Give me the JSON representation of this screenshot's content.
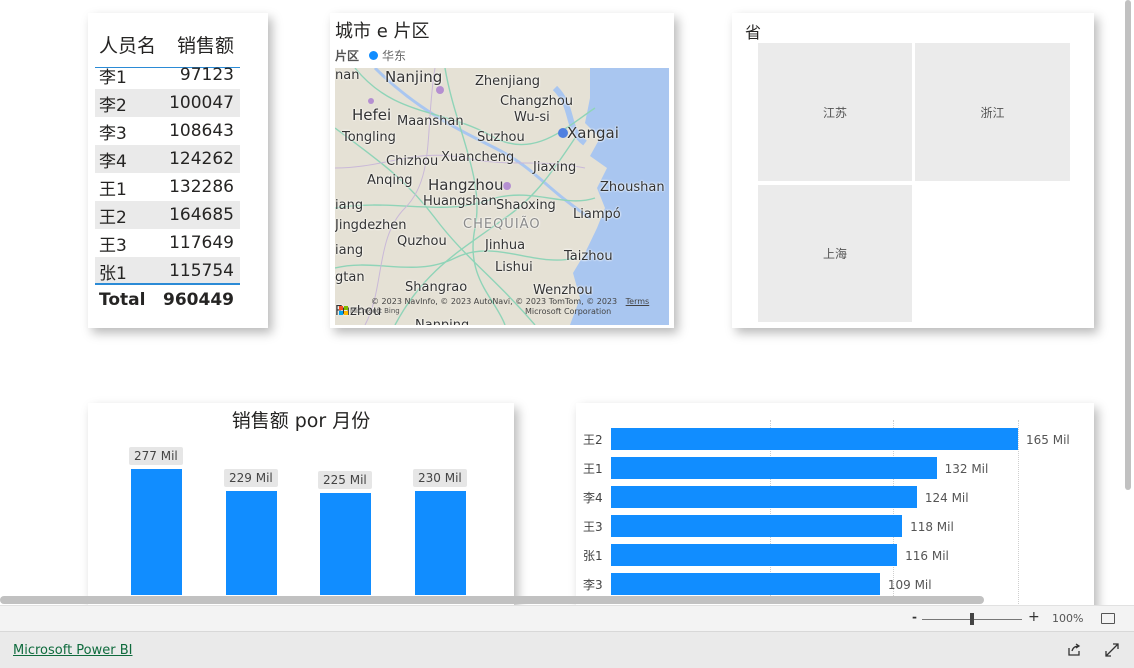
{
  "table": {
    "headers": [
      "人员名",
      "销售额"
    ],
    "rows": [
      {
        "name": "李1",
        "value": "97123"
      },
      {
        "name": "李2",
        "value": "100047"
      },
      {
        "name": "李3",
        "value": "108643"
      },
      {
        "name": "李4",
        "value": "124262"
      },
      {
        "name": "王1",
        "value": "132286"
      },
      {
        "name": "王2",
        "value": "164685"
      },
      {
        "name": "王3",
        "value": "117649"
      },
      {
        "name": "张1",
        "value": "115754"
      }
    ],
    "total_label": "Total",
    "total_value": "960449"
  },
  "map": {
    "title": "城市 e 片区",
    "legend_title": "片区",
    "legend_item": "华东",
    "legend_color": "#118dff",
    "places": [
      "Nanjing",
      "Zhenjiang",
      "Changzhou",
      "Hefei",
      "Maanshan",
      "Wu-si",
      "Xangai",
      "Tongling",
      "Suzhou",
      "Chizhou",
      "Xuancheng",
      "Jiaxing",
      "Anqing",
      "Hangzhou",
      "Zhoushan",
      "Huangshan",
      "Shaoxing",
      "Liampó",
      "Jingdezhen",
      "CHEQUIÃO",
      "Quzhou",
      "Jinhua",
      "Lishui",
      "Taizhou",
      "Shangrao",
      "Wenzhou",
      "Fuzhou",
      "Nanping",
      "iang",
      "nan",
      "gtan",
      "iang"
    ],
    "copyright": "© 2023 NavInfo, © 2023 AutoNavi, © 2023 TomTom, © 2023",
    "copyright2": "Microsoft Corporation",
    "terms": "Terms",
    "ms_brand": "Microsoft Bing"
  },
  "treemap": {
    "title": "省",
    "tiles": [
      "江苏",
      "浙江",
      "上海"
    ]
  },
  "column_chart": {
    "title": "销售额 por 月份"
  },
  "bar_chart": {},
  "chart_data": [
    {
      "type": "bar",
      "title": "销售额 por 月份",
      "categories": [],
      "values": [
        277,
        229,
        225,
        230
      ],
      "data_labels": [
        "277 Mil",
        "229 Mil",
        "225 Mil",
        "230 Mil"
      ],
      "ylim": [
        0,
        300
      ],
      "grid": false,
      "color": "#118dff"
    },
    {
      "type": "bar",
      "orientation": "horizontal",
      "categories": [
        "王2",
        "王1",
        "李4",
        "王3",
        "张1",
        "李3"
      ],
      "values": [
        165,
        132,
        124,
        118,
        116,
        109
      ],
      "data_labels": [
        "165 Mil",
        "132 Mil",
        "124 Mil",
        "118 Mil",
        "116 Mil",
        "109 Mil"
      ],
      "xlim": [
        0,
        165
      ],
      "grid": true,
      "color": "#118dff"
    }
  ],
  "zoom": {
    "minus": "-",
    "plus": "+",
    "percent": "100%",
    "level": 0.5
  },
  "footer": {
    "brand": "Microsoft Power BI"
  },
  "icons": {
    "share": "share-icon",
    "expand": "expand-icon",
    "fit": "fit-to-page-icon"
  }
}
